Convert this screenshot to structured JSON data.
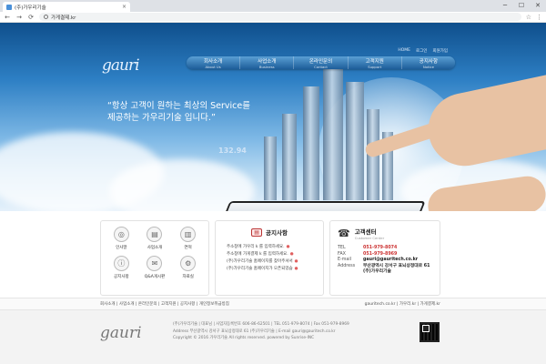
{
  "browser": {
    "tab_title": "(주)가우리기술",
    "url": "가게결제.kr",
    "back": "←",
    "forward": "→",
    "reload": "⟳",
    "star": "☆",
    "menu": "⋮",
    "win_min": "─",
    "win_max": "☐",
    "win_close": "✕",
    "tab_close": "×"
  },
  "header": {
    "logo": "gauri",
    "util_links": [
      "HOME",
      "로그인",
      "회원가입"
    ],
    "nav": [
      {
        "label": "회사소개",
        "sub": "About Us"
      },
      {
        "label": "사업소개",
        "sub": "Business"
      },
      {
        "label": "온라인문의",
        "sub": "Contact"
      },
      {
        "label": "고객지원",
        "sub": "Support"
      },
      {
        "label": "공지사항",
        "sub": "Notice"
      }
    ]
  },
  "hero": {
    "slogan_line1": "“항상 고객이 원하는 최상의 Service를",
    "slogan_line2": "제공하는 가우리기술 입니다.”",
    "chart_number": "132.94"
  },
  "quick_menu": [
    {
      "label": "인사말",
      "icon": "globe-icon",
      "glyph": "◎"
    },
    {
      "label": "사업소개",
      "icon": "document-icon",
      "glyph": "▤"
    },
    {
      "label": "연혁",
      "icon": "chart-icon",
      "glyph": "▥"
    },
    {
      "label": "공지사항",
      "icon": "notice-icon",
      "glyph": "ⓘ"
    },
    {
      "label": "Q&A게시판",
      "icon": "qa-icon",
      "glyph": "✉"
    },
    {
      "label": "자료실",
      "icon": "gear-icon",
      "glyph": "⚙"
    }
  ],
  "notice": {
    "title": "공지사항",
    "items": [
      "주소창에 가우리 k 를 입력하세요.",
      "주소창에 가게결제 k 를 입력하세요.",
      "(주)가우리기술 홈페이지를 찾아주셔서",
      "(주)가우리기술 홈페이지가 오픈되었습"
    ]
  },
  "customer": {
    "title": "고객센터",
    "subtitle": "Customer Center",
    "rows": [
      {
        "key": "TEL",
        "value": "051-979-8074"
      },
      {
        "key": "FAX",
        "value": "051-979-8969"
      },
      {
        "key": "E-mail",
        "value": "gauri@gauritech.co.kr"
      },
      {
        "key": "Address",
        "value": "부산광역시 강서구 표뇌상정대로 61"
      },
      {
        "key": "",
        "value": "(주)가우리기술"
      }
    ]
  },
  "footer": {
    "links": "회사소개 | 사업소개 | 온라인문의 | 고객지원 | 공지사항 | 개인정보취급방침",
    "sites": "gauritech.co.kr | 가우리.kr | 가게결제.kr",
    "logo": "gauri",
    "line1": "(주)가우리기술 | 대표님 | 사업자등록번호 606-86-62501 | TEL 051-979-8074 | Fax 051-979-8969",
    "line2": "Address 부산광역시 강서구 표뇌상정대로 61 (주)가우리기술 | E-mail gauri@gauritech.co.kr",
    "line3": "Copyright © 2016 가우리기술 All rights reserved. powered by Sunrise-INC"
  },
  "colors": {
    "nav_top": "#5a9fd4",
    "nav_bottom": "#1d5d99",
    "accent_red": "#cc3333"
  }
}
